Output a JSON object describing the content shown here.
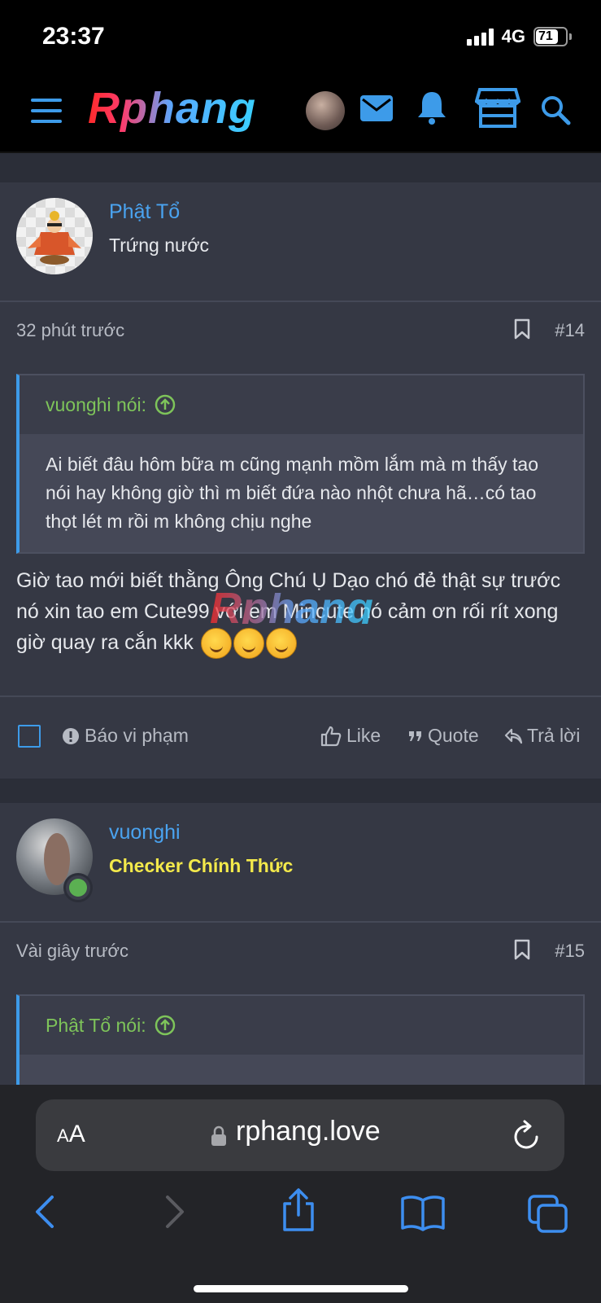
{
  "status": {
    "time": "23:37",
    "network": "4G",
    "battery": "71",
    "battery_fraction": 0.71
  },
  "header": {
    "logo": "Rphang"
  },
  "posts": [
    {
      "username": "Phật Tổ",
      "user_title": "Trứng nước",
      "time": "32 phút trước",
      "number": "#14",
      "quote_author": "vuonghi nói:",
      "quote_text": "Ai biết đâu hôm bữa m cũng mạnh mồm lắm mà m thấy tao nói hay không giờ thì m biết đứa nào nhột chưa hã…có tao thọt lét m rồi m không chịu nghe",
      "body": "Giờ tao mới biết thằng Ông Chú Ụ Dạo chó đẻ thật sự trước nó xin tao em Cute99 với em Mincute nó cảm ơn rối rít xong giờ quay ra cắn kkk"
    },
    {
      "username": "vuonghi",
      "user_title": "Checker Chính Thức",
      "time": "Vài giây trước",
      "number": "#15",
      "quote_author": "Phật Tổ nói:"
    }
  ],
  "actions": {
    "report": "Báo vi phạm",
    "like": "Like",
    "quote": "Quote",
    "reply": "Trả lời"
  },
  "watermark": "Rphang",
  "browser": {
    "aa_large": "A",
    "aa_small": "A",
    "url": "rphang.love"
  },
  "colors": {
    "accent": "#3d9be9",
    "quote_author": "#7ec45a",
    "title_gold": "#f3e94b",
    "online": "#5bb052"
  }
}
